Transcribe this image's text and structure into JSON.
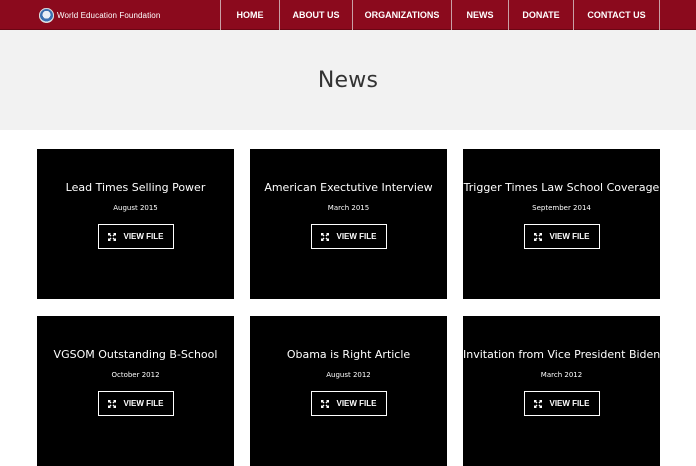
{
  "brand": {
    "name": "World Education Foundation"
  },
  "nav": [
    {
      "label": "HOME",
      "name": "nav-home"
    },
    {
      "label": "ABOUT US",
      "name": "nav-about-us"
    },
    {
      "label": "ORGANIZATIONS",
      "name": "nav-organizations"
    },
    {
      "label": "NEWS",
      "name": "nav-news"
    },
    {
      "label": "DONATE",
      "name": "nav-donate"
    },
    {
      "label": "CONTACT US",
      "name": "nav-contact-us"
    }
  ],
  "page": {
    "title": "News"
  },
  "cards": [
    {
      "title": "Lead Times Selling Power",
      "date": "August 2015",
      "button": "VIEW FILE",
      "icon": "expand-icon"
    },
    {
      "title": "American Exectutive Interview",
      "date": "March 2015",
      "button": "VIEW FILE",
      "icon": "expand-icon"
    },
    {
      "title": "Trigger Times Law School Coverage",
      "date": "September 2014",
      "button": "VIEW FILE",
      "icon": "expand-icon"
    },
    {
      "title": "VGSOM Outstanding B-School",
      "date": "October 2012",
      "button": "VIEW FILE",
      "icon": "expand-icon"
    },
    {
      "title": "Obama is Right Article",
      "date": "August 2012",
      "button": "VIEW FILE",
      "icon": "expand-icon"
    },
    {
      "title": "Invitation from Vice President Biden",
      "date": "March 2012",
      "button": "VIEW FILE",
      "icon": "expand-icon"
    }
  ],
  "colors": {
    "navbar": "#8b0a1d",
    "hero_bg": "#f2f2f2",
    "card_bg": "#000000",
    "text_light": "#ffffff"
  }
}
